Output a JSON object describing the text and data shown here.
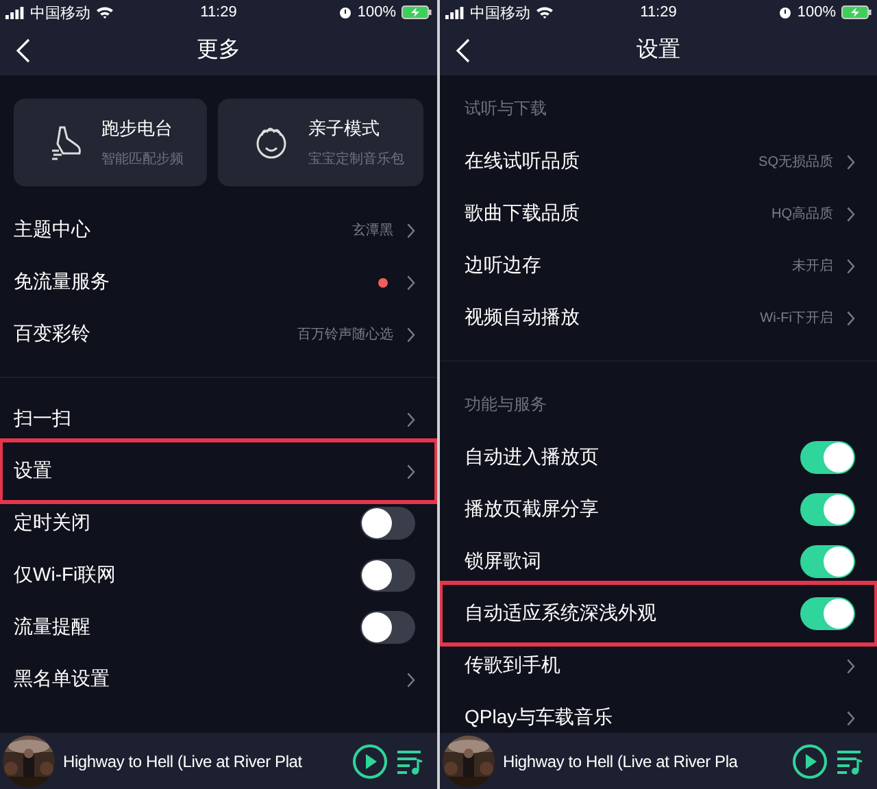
{
  "phones": [
    {
      "status_bar": {
        "carrier": "中国移动",
        "time": "11:29",
        "battery": "100%"
      },
      "title": "更多",
      "cards": [
        {
          "kind": "running",
          "title": "跑步电台",
          "subtitle": "智能匹配步频"
        },
        {
          "kind": "kids",
          "title": "亲子模式",
          "subtitle": "宝宝定制音乐包"
        }
      ],
      "groups": [
        {
          "rows": [
            {
              "kind": "value",
              "label": "主题中心",
              "value": "玄潭黑",
              "highlighted": false
            },
            {
              "kind": "dot",
              "label": "免流量服务",
              "highlighted": false
            },
            {
              "kind": "value",
              "label": "百变彩铃",
              "value": "百万铃声随心选",
              "highlighted": false
            }
          ]
        },
        {
          "rows": [
            {
              "kind": "value",
              "label": "扫一扫",
              "highlighted": false
            },
            {
              "kind": "value",
              "label": "设置",
              "highlighted": true
            },
            {
              "kind": "toggle",
              "label": "定时关闭",
              "on": false,
              "highlighted": false
            },
            {
              "kind": "toggle",
              "label": "仅Wi-Fi联网",
              "on": false,
              "highlighted": false
            },
            {
              "kind": "toggle",
              "label": "流量提醒",
              "on": false,
              "highlighted": false
            },
            {
              "kind": "value",
              "label": "黑名单设置",
              "highlighted": false
            }
          ]
        }
      ],
      "player": {
        "track": "Highway to Hell (Live at River Plat"
      }
    },
    {
      "status_bar": {
        "carrier": "中国移动",
        "time": "11:29",
        "battery": "100%"
      },
      "title": "设置",
      "groups": [
        {
          "heading": "试听与下载",
          "rows": [
            {
              "kind": "value",
              "label": "在线试听品质",
              "value": "SQ无损品质",
              "highlighted": false
            },
            {
              "kind": "value",
              "label": "歌曲下载品质",
              "value": "HQ高品质",
              "highlighted": false
            },
            {
              "kind": "value",
              "label": "边听边存",
              "value": "未开启",
              "highlighted": false
            },
            {
              "kind": "value",
              "label": "视频自动播放",
              "value": "Wi-Fi下开启",
              "highlighted": false
            }
          ]
        },
        {
          "heading": "功能与服务",
          "rows": [
            {
              "kind": "toggle",
              "label": "自动进入播放页",
              "on": true,
              "highlighted": false
            },
            {
              "kind": "toggle",
              "label": "播放页截屏分享",
              "on": true,
              "highlighted": false
            },
            {
              "kind": "toggle",
              "label": "锁屏歌词",
              "on": true,
              "highlighted": false
            },
            {
              "kind": "toggle",
              "label": "自动适应系统深浅外观",
              "on": true,
              "highlighted": true
            },
            {
              "kind": "value",
              "label": "传歌到手机",
              "highlighted": false
            },
            {
              "kind": "value",
              "label": "QPlay与车载音乐",
              "highlighted": false
            }
          ]
        }
      ],
      "player": {
        "track": "Highway to Hell (Live at River Pla"
      }
    }
  ]
}
